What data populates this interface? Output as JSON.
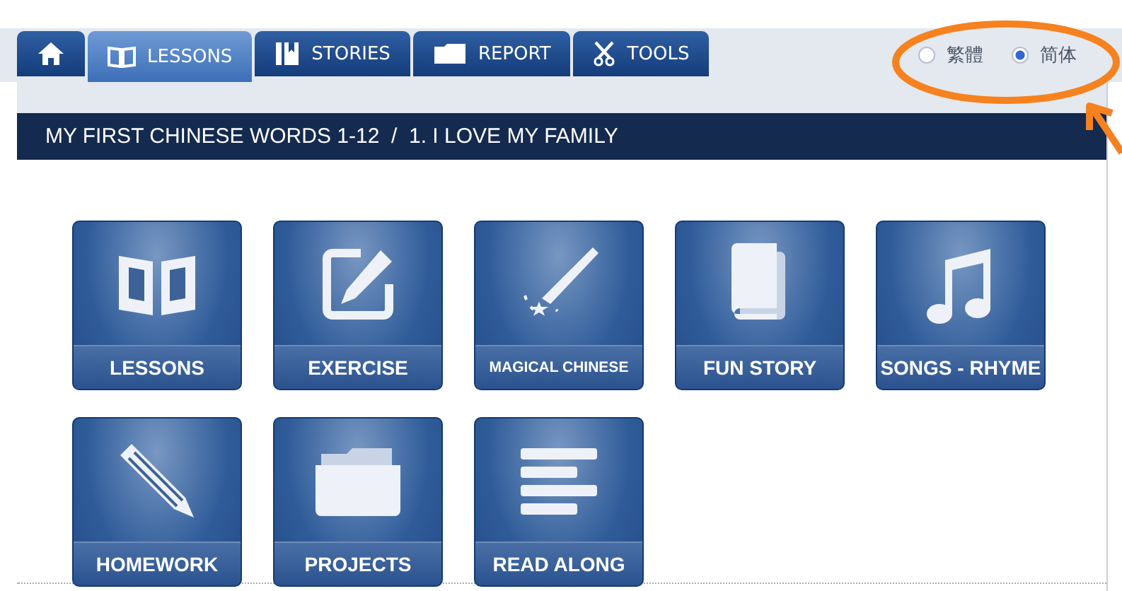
{
  "tabs": [
    {
      "kind": "home",
      "selected": false
    },
    {
      "kind": "lessons",
      "label": "LESSONS",
      "selected": true
    },
    {
      "kind": "stories",
      "label": "STORIES",
      "selected": false
    },
    {
      "kind": "report",
      "label": "REPORT",
      "selected": false
    },
    {
      "kind": "tools",
      "label": "TOOLS",
      "selected": false
    }
  ],
  "script_options": [
    {
      "label": "繁體",
      "selected": false
    },
    {
      "label": "简体",
      "selected": true
    }
  ],
  "breadcrumb": "MY FIRST CHINESE WORDS 1-12  /  1. I LOVE MY FAMILY",
  "tiles": [
    {
      "kind": "book",
      "label": "LESSONS"
    },
    {
      "kind": "edit",
      "label": "EXERCISE"
    },
    {
      "kind": "wand",
      "label": "MAGICAL CHINESE"
    },
    {
      "kind": "storybook",
      "label": "FUN STORY"
    },
    {
      "kind": "music",
      "label": "SONGS - RHYME"
    },
    {
      "kind": "pencil",
      "label": "HOMEWORK"
    },
    {
      "kind": "folder",
      "label": "PROJECTS"
    },
    {
      "kind": "lines",
      "label": "READ ALONG"
    }
  ]
}
